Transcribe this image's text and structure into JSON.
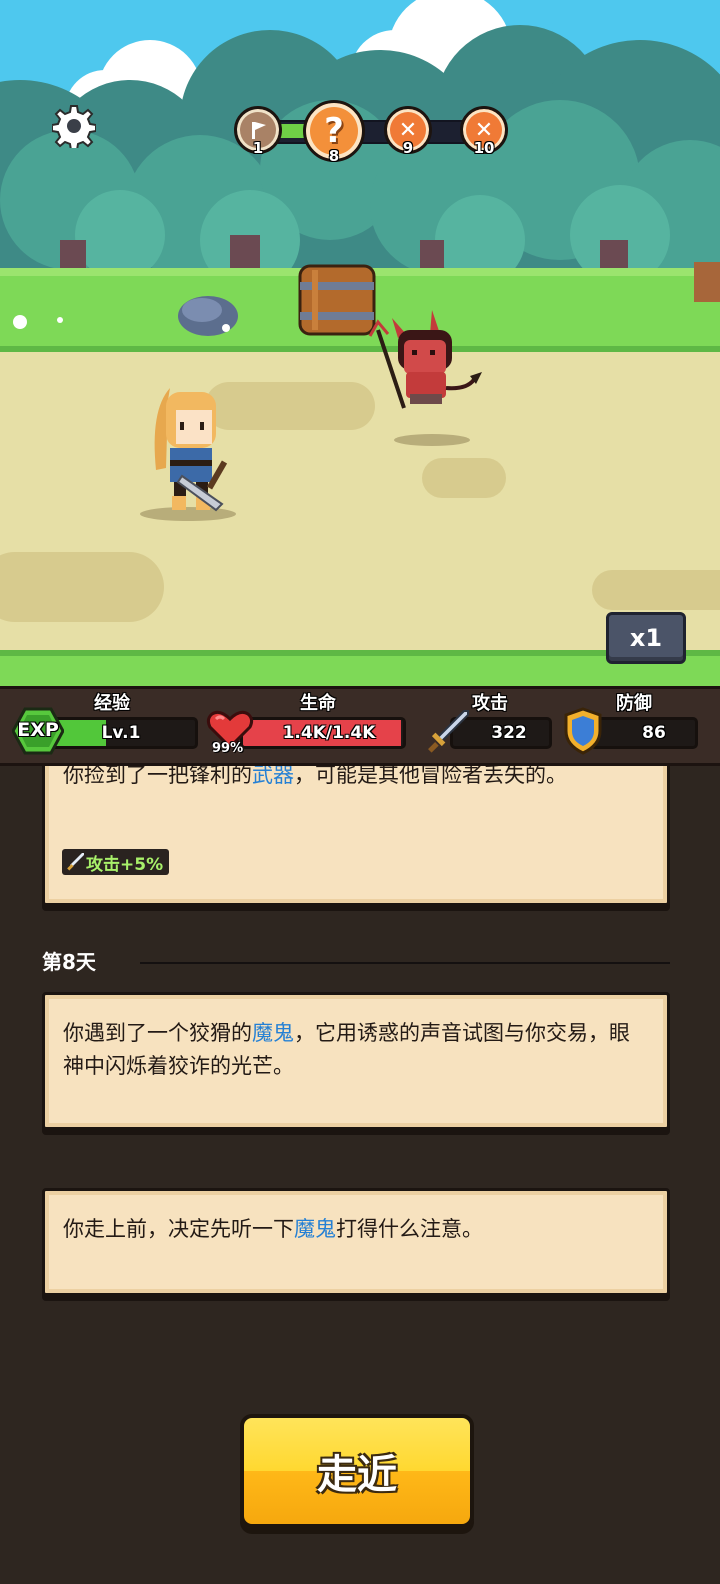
{
  "stages": [
    {
      "num": "1",
      "state": "completed",
      "icon": "flag-icon"
    },
    {
      "num": "8",
      "state": "current",
      "icon": "question-mark-icon"
    },
    {
      "num": "9",
      "state": "battle",
      "icon": "crossed-swords-icon"
    },
    {
      "num": "10",
      "state": "battle",
      "icon": "crossed-swords-icon"
    }
  ],
  "speed": {
    "label": "x1"
  },
  "stats": {
    "exp": {
      "label": "经验",
      "badge": "EXP",
      "level": "Lv.1",
      "progress": 0.4,
      "color": "#52c73a"
    },
    "hp": {
      "label": "生命",
      "value": "1.4K/1.4K",
      "percent": "99%",
      "fill": 0.99,
      "color": "#e5424a"
    },
    "attack": {
      "label": "攻击",
      "value": "322"
    },
    "defense": {
      "label": "防御",
      "value": "86"
    }
  },
  "log": {
    "card1": {
      "pre": "你捡到了一把锋利的",
      "kw": "武器",
      "post": "，可能是其他冒险者丢失的。",
      "buff": "攻击+5%"
    },
    "day": "第8天",
    "card2": {
      "pre": "你遇到了一个狡猾的",
      "kw": "魔鬼",
      "post": "，它用诱惑的声音试图与你交易，眼神中闪烁着狡诈的光芒。"
    },
    "card3": {
      "pre": "你走上前，决定先听一下",
      "kw": "魔鬼",
      "post": "打得什么注意。"
    }
  },
  "action": {
    "label": "走近"
  },
  "colors": {
    "keyword": "#2580d4",
    "buff_text": "#a8f06a",
    "button": "#ffc824"
  }
}
